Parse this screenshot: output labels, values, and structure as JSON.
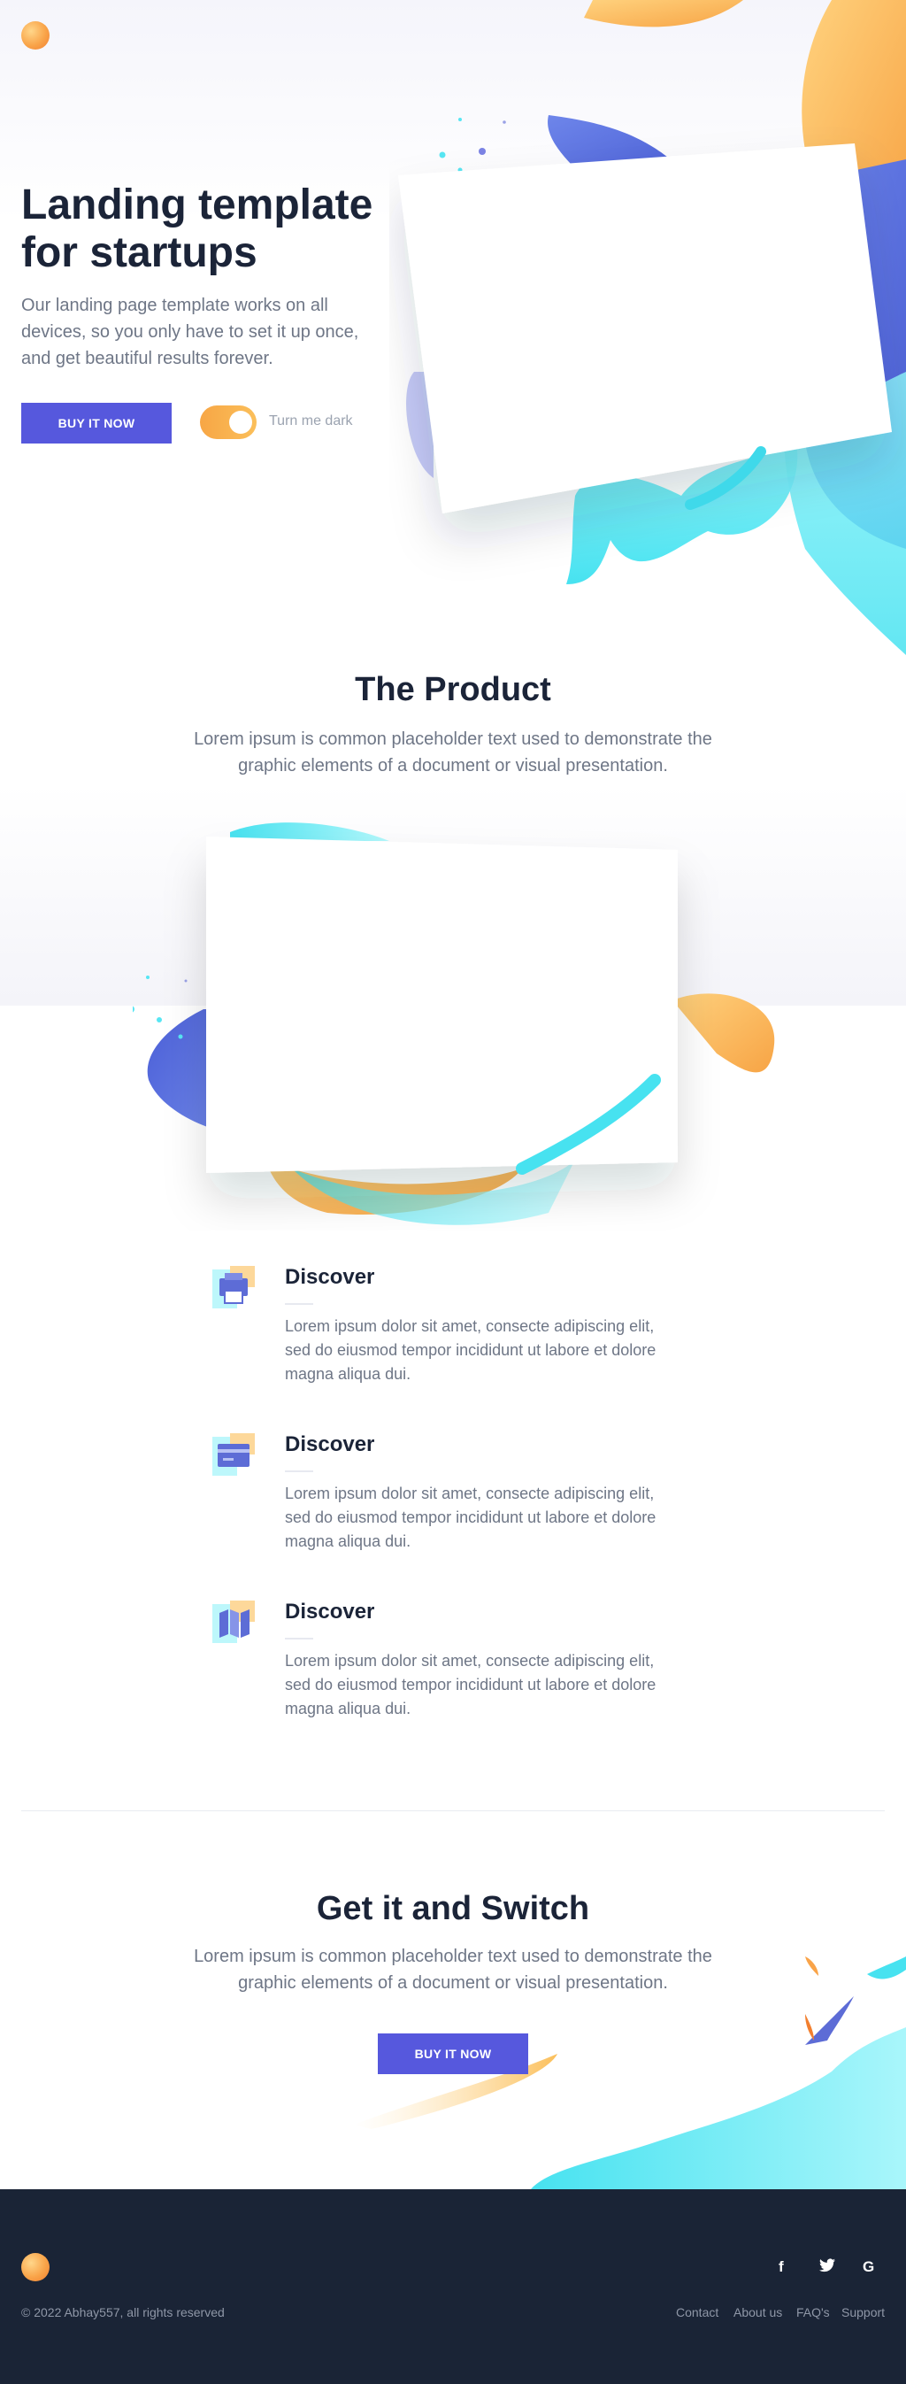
{
  "hero": {
    "title": "Landing template for startups",
    "text": "Our landing page template works on all devices, so you only have to set it up once, and get beautiful results forever.",
    "cta_label": "BUY IT NOW",
    "toggle_label": "Turn me dark"
  },
  "product": {
    "title": "The Product",
    "text": "Lorem ipsum is common placeholder text used to demonstrate the graphic elements of a document or visual presentation."
  },
  "features": [
    {
      "icon": "printer-icon",
      "title": "Discover",
      "text": "Lorem ipsum dolor sit amet, consecte adipiscing elit, sed do eiusmod tempor incididunt ut labore et dolore magna aliqua dui."
    },
    {
      "icon": "credit-card-icon",
      "title": "Discover",
      "text": "Lorem ipsum dolor sit amet, consecte adipiscing elit, sed do eiusmod tempor incididunt ut labore et dolore magna aliqua dui."
    },
    {
      "icon": "map-icon",
      "title": "Discover",
      "text": "Lorem ipsum dolor sit amet, consecte adipiscing elit, sed do eiusmod tempor incididunt ut labore et dolore magna aliqua dui."
    }
  ],
  "cta": {
    "title": "Get it and Switch",
    "text": "Lorem ipsum is common placeholder text used to demonstrate the graphic elements of a document or visual presentation.",
    "button_label": "BUY IT NOW"
  },
  "footer": {
    "copyright": "© 2022 Abhay557, all rights reserved",
    "links": [
      "Contact",
      "About us",
      "FAQ's",
      "Support"
    ],
    "social": [
      {
        "icon": "facebook-icon",
        "glyph": "f"
      },
      {
        "icon": "twitter-icon",
        "glyph": "t"
      },
      {
        "icon": "google-icon",
        "glyph": "G"
      }
    ]
  },
  "colors": {
    "accent": "#5658dd",
    "orange": "#f9a449",
    "cyan": "#57e6f3",
    "dark": "#1a2436",
    "text": "#6e7686"
  }
}
